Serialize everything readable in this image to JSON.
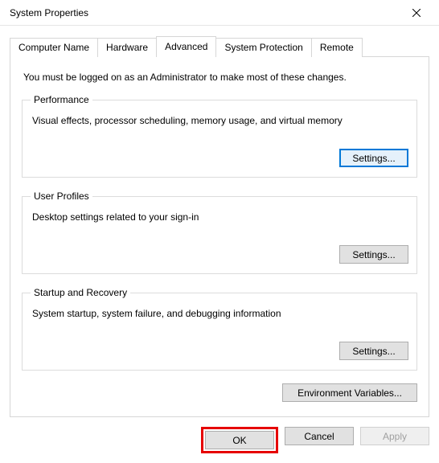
{
  "window": {
    "title": "System Properties"
  },
  "tabs": {
    "computer_name": "Computer Name",
    "hardware": "Hardware",
    "advanced": "Advanced",
    "system_protection": "System Protection",
    "remote": "Remote"
  },
  "advanced": {
    "intro": "You must be logged on as an Administrator to make most of these changes.",
    "performance": {
      "legend": "Performance",
      "desc": "Visual effects, processor scheduling, memory usage, and virtual memory",
      "settings_btn": "Settings..."
    },
    "user_profiles": {
      "legend": "User Profiles",
      "desc": "Desktop settings related to your sign-in",
      "settings_btn": "Settings..."
    },
    "startup_recovery": {
      "legend": "Startup and Recovery",
      "desc": "System startup, system failure, and debugging information",
      "settings_btn": "Settings..."
    },
    "env_vars_btn": "Environment Variables..."
  },
  "buttons": {
    "ok": "OK",
    "cancel": "Cancel",
    "apply": "Apply"
  }
}
